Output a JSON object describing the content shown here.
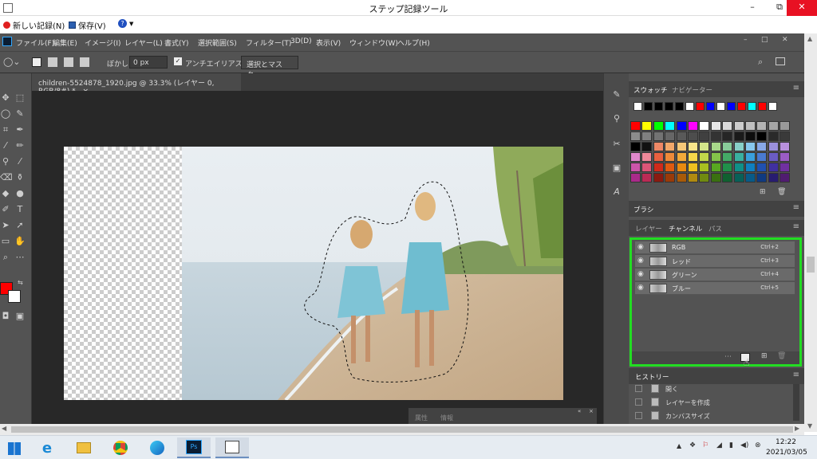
{
  "window": {
    "title": "ステップ記録ツール",
    "minimize": "–",
    "maximize": "⧉",
    "close": "✕"
  },
  "psr_toolbar": {
    "new_record": "新しい記録(N)",
    "save": "保存(V)",
    "help_icon": "help-circle-icon"
  },
  "ps_menu": [
    "ファイル(F)",
    "編集(E)",
    "イメージ(I)",
    "レイヤー(L)",
    "書式(Y)",
    "選択範囲(S)",
    "フィルター(T)",
    "3D(D)",
    "表示(V)",
    "ウィンドウ(W)",
    "ヘルプ(H)"
  ],
  "options": {
    "feather_label": "ぼかし：",
    "feather_value": "0 px",
    "antialias_label": "アンチエイリアス",
    "antialias_checked": true,
    "select_mask_label": "選択とマスク..."
  },
  "document": {
    "tab_title": "children-5524878_1920.jpg @ 33.3% (レイヤー 0, RGB/8#) *",
    "tab_close": "×"
  },
  "swatches_panel": {
    "tabs": [
      "スウォッチ",
      "ナビゲーター"
    ],
    "recent": [
      "#ffffff",
      "#000000",
      "#000000",
      "#000000",
      "#000000",
      "#ffffff",
      "#ff0000",
      "#0000ff",
      "#ffffff",
      "#0000ff",
      "#ff0000",
      "#00ffff",
      "#ff0000",
      "#ffffff"
    ],
    "grid": [
      [
        "#ff0000",
        "#ffff00",
        "#00ff00",
        "#00ffff",
        "#0000ff",
        "#ff00ff",
        "#ffffff",
        "#e6e6e6",
        "#d9d9d9",
        "#cccccc",
        "#bfbfbf",
        "#b3b3b3",
        "#a6a6a6",
        "#999999"
      ],
      [
        "#8c8c8c",
        "#808080",
        "#737373",
        "#666666",
        "#595959",
        "#4d4d4d",
        "#404040",
        "#333333",
        "#262626",
        "#1a1a1a",
        "#0d0d0d",
        "#000000",
        "#2a2a2a",
        "#3a3a3a"
      ],
      [
        "#000000",
        "#111111",
        "#ee8866",
        "#f2a86a",
        "#f5c878",
        "#f8e48a",
        "#d4e68a",
        "#a8d88a",
        "#88cc99",
        "#88d0c8",
        "#88c8ee",
        "#88a8e8",
        "#9a90dd",
        "#b890dd"
      ],
      [
        "#e088cc",
        "#ee8899",
        "#e86040",
        "#ee8a3a",
        "#f2aa3a",
        "#f6d84a",
        "#c2d84a",
        "#84c44a",
        "#44aa66",
        "#3ab0a0",
        "#3aa0dc",
        "#4a7ad0",
        "#6a5cc4",
        "#9a5cc4"
      ],
      [
        "#cc55aa",
        "#dd5577",
        "#d02a1a",
        "#e05a10",
        "#e88a10",
        "#eec020",
        "#a8c020",
        "#58a820",
        "#20904a",
        "#109088",
        "#1080c0",
        "#2050b0",
        "#4030a0",
        "#7030a0"
      ],
      [
        "#aa2a8a",
        "#bb2a55",
        "#8a1a10",
        "#9a3a08",
        "#a85a08",
        "#b08a10",
        "#708a10",
        "#3a7010",
        "#106030",
        "#086058",
        "#085a88",
        "#103a80",
        "#281c70",
        "#501c70"
      ]
    ]
  },
  "brush_panel": {
    "label": "ブラシ"
  },
  "layers_panel": {
    "tabs": [
      "レイヤー",
      "チャンネル",
      "パス"
    ],
    "channels": [
      {
        "name": "RGB",
        "shortcut": "Ctrl+2"
      },
      {
        "name": "レッド",
        "shortcut": "Ctrl+3"
      },
      {
        "name": "グリーン",
        "shortcut": "Ctrl+4"
      },
      {
        "name": "ブルー",
        "shortcut": "Ctrl+5"
      }
    ]
  },
  "history_panel": {
    "title": "ヒストリー",
    "items": [
      "開く",
      "レイヤーを作成",
      "カンバスサイズ"
    ]
  },
  "info_panel": {
    "tabs": [
      "属性",
      "情報"
    ]
  },
  "taskbar": {
    "time": "12:22",
    "date": "2021/03/05"
  },
  "accent": {
    "highlight_green": "#22dd22",
    "fg_color": "#ff0000",
    "bg_color": "#ffffff",
    "ps_bg": "#535353"
  }
}
